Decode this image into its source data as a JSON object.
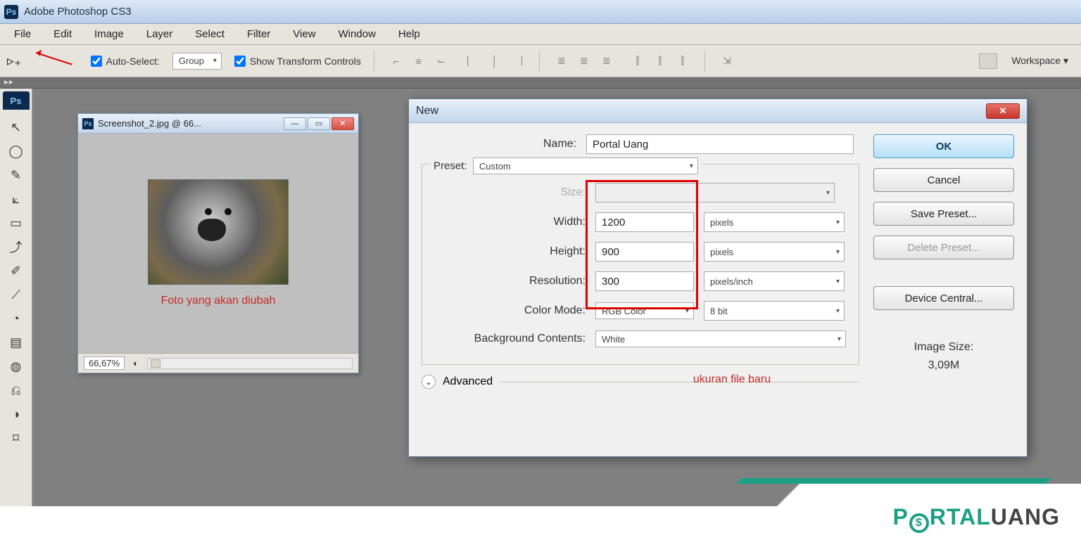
{
  "titlebar": {
    "app_name": "Adobe Photoshop CS3"
  },
  "menubar": [
    "File",
    "Edit",
    "Image",
    "Layer",
    "Select",
    "Filter",
    "View",
    "Window",
    "Help"
  ],
  "optbar": {
    "auto_select": "Auto-Select:",
    "group": "Group",
    "show_transform": "Show Transform Controls",
    "workspace": "Workspace ▾"
  },
  "tools": [
    "↖",
    "◯",
    "✎",
    "⟀",
    "▭",
    "⤴",
    "✐",
    "⟋",
    "◔",
    "▤",
    "◍",
    "⎌",
    "◑",
    "⌑"
  ],
  "doc": {
    "title": "Screenshot_2.jpg @ 66...",
    "caption": "Foto yang akan diubah",
    "zoom": "66,67%"
  },
  "dialog": {
    "title": "New",
    "name_label": "Name:",
    "name_value": "Portal Uang",
    "preset_label": "Preset:",
    "preset_value": "Custom",
    "size_label": "Size:",
    "width_label": "Width:",
    "width_value": "1200",
    "width_unit": "pixels",
    "height_label": "Height:",
    "height_value": "900",
    "height_unit": "pixels",
    "res_label": "Resolution:",
    "res_value": "300",
    "res_unit": "pixels/inch",
    "colormode_label": "Color Mode:",
    "colormode_value": "RGB Color",
    "colordepth": "8 bit",
    "bg_label": "Background Contents:",
    "bg_value": "White",
    "advanced": "Advanced",
    "note": "ukuran file baru",
    "buttons": {
      "ok": "OK",
      "cancel": "Cancel",
      "save_preset": "Save Preset...",
      "delete_preset": "Delete Preset...",
      "device_central": "Device Central..."
    },
    "imgsize_label": "Image Size:",
    "imgsize_value": "3,09M"
  },
  "watermark": {
    "p": "P",
    "rtal": "RTAL",
    "uang": "UANG",
    "dollar": "$"
  }
}
